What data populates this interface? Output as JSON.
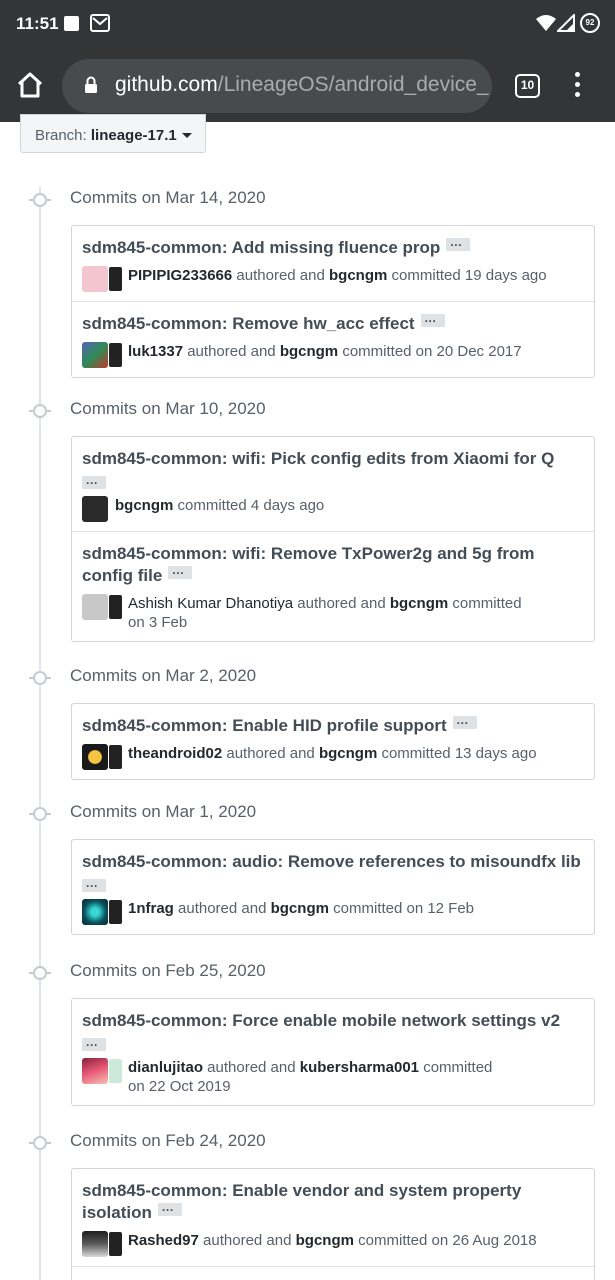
{
  "status_bar": {
    "time": "11:51",
    "battery": "92"
  },
  "browser": {
    "url_domain": "github.com",
    "url_path": "/LineageOS/android_device_",
    "tab_count": "10"
  },
  "branch": {
    "label": "Branch:",
    "value": "lineage-17.1"
  },
  "groups": [
    {
      "title": "Commits on Mar 14, 2020",
      "commits": [
        {
          "message": "sdm845-common: Add missing fluence prop",
          "author": "PIPIPIG233666",
          "mid": "authored and",
          "committer": "bgcngm",
          "when": "committed 19 days ago",
          "avatar_color": "#f2c5cf"
        },
        {
          "message": "sdm845-common: Remove hw_acc effect",
          "author": "luk1337",
          "mid": "authored and",
          "committer": "bgcngm",
          "when": "committed on 20 Dec 2017",
          "avatar_color": "#5a5fb8"
        }
      ]
    },
    {
      "title": "Commits on Mar 10, 2020",
      "commits": [
        {
          "message": "sdm845-common: wifi: Pick config edits from Xiaomi for Q",
          "author": "bgcngm",
          "when": "committed 4 days ago",
          "avatar_color": "#2a2a2a"
        },
        {
          "message": "sdm845-common: wifi: Remove TxPower2g and 5g from config file",
          "author": "Ashish Kumar Dhanotiya",
          "mid": "authored and",
          "committer": "bgcngm",
          "when": "committed",
          "when2": "on 3 Feb",
          "avatar_color": "#c8c8c8"
        }
      ]
    },
    {
      "title": "Commits on Mar 2, 2020",
      "commits": [
        {
          "message": "sdm845-common: Enable HID profile support",
          "author": "theandroid02",
          "mid": "authored and",
          "committer": "bgcngm",
          "when": "committed 13 days ago",
          "avatar_color": "#e3a31b"
        }
      ]
    },
    {
      "title": "Commits on Mar 1, 2020",
      "commits": [
        {
          "message": "sdm845-common: audio: Remove references to misoundfx lib",
          "author": "1nfrag",
          "mid": "authored and",
          "committer": "bgcngm",
          "when": "committed on 12 Feb",
          "avatar_color": "#0b6f7a"
        }
      ]
    },
    {
      "title": "Commits on Feb 25, 2020",
      "commits": [
        {
          "message": "sdm845-common: Force enable mobile network settings v2",
          "author": "dianlujitao",
          "mid": "authored and",
          "committer": "kubersharma001",
          "when": "committed",
          "when2": "on 22 Oct 2019",
          "avatar_color": "#d8506a"
        }
      ]
    },
    {
      "title": "Commits on Feb 24, 2020",
      "commits": [
        {
          "message": "sdm845-common: Enable vendor and system property isolation",
          "author": "Rashed97",
          "mid": "authored and",
          "committer": "bgcngm",
          "when": "committed on 26 Aug 2018",
          "avatar_color": "#3a3a3a"
        }
      ]
    }
  ]
}
